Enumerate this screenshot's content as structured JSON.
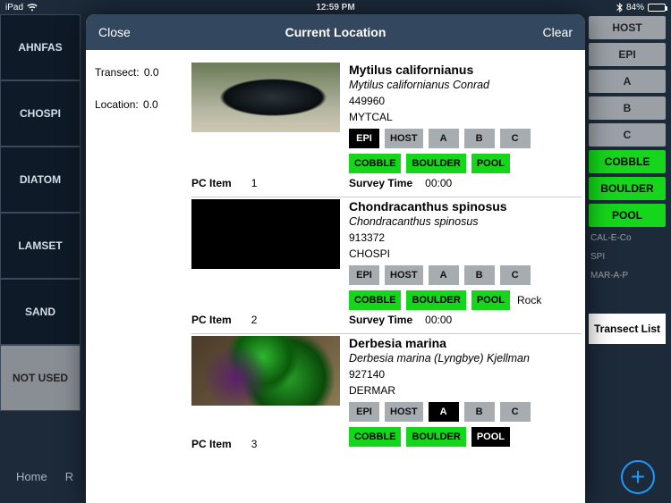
{
  "status": {
    "device": "iPad",
    "time": "12:59 PM",
    "battery": "84%"
  },
  "bgSidebar": [
    "AHNFAS",
    "CHOSPI",
    "DIATOM",
    "LAMSET",
    "SAND",
    "NOT USED"
  ],
  "bgBottom": {
    "home": "Home",
    "r": "R"
  },
  "bgRight": {
    "chips": [
      "HOST",
      "EPI",
      "A",
      "B",
      "C",
      "COBBLE",
      "BOULDER",
      "POOL"
    ],
    "texts": [
      "CAL-E-Co",
      "SPI",
      "MAR-A-P"
    ],
    "transectList": "Transect List"
  },
  "modal": {
    "header": {
      "close": "Close",
      "title": "Current Location",
      "clear": "Clear"
    },
    "left": {
      "transectLabel": "Transect:",
      "transectValue": "0.0",
      "locationLabel": "Location:",
      "locationValue": "0.0"
    },
    "labels": {
      "pcItem": "PC Item",
      "surveyTime": "Survey Time"
    },
    "items": [
      {
        "pcItem": "1",
        "name": "Mytilus californianus",
        "sci": "Mytilus californianus Conrad",
        "num": "449960",
        "code": "MYTCAL",
        "row1": [
          "EPI",
          "HOST",
          "A",
          "B",
          "C"
        ],
        "row2": [
          "COBBLE",
          "BOULDER",
          "POOL"
        ],
        "surveyTime": "00:00"
      },
      {
        "pcItem": "2",
        "name": "Chondracanthus spinosus",
        "sci": "Chondracanthus spinosus",
        "num": "913372",
        "code": "CHOSPI",
        "row1": [
          "EPI",
          "HOST",
          "A",
          "B",
          "C"
        ],
        "row2": [
          "COBBLE",
          "BOULDER",
          "POOL"
        ],
        "extra": "Rock",
        "surveyTime": "00:00"
      },
      {
        "pcItem": "3",
        "name": "Derbesia marina",
        "sci": "Derbesia marina (Lyngbye) Kjellman",
        "num": "927140",
        "code": "DERMAR",
        "row1": [
          "EPI",
          "HOST",
          "A",
          "B",
          "C"
        ],
        "row2": [
          "COBBLE",
          "BOULDER",
          "POOL"
        ]
      }
    ]
  }
}
